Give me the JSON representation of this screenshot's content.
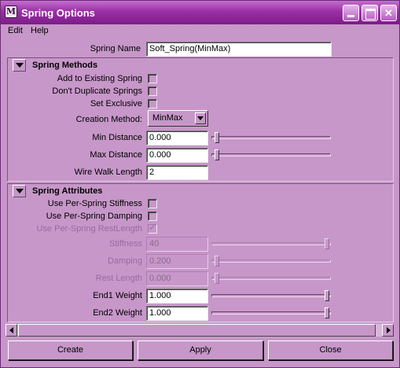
{
  "window": {
    "title": "Spring Options",
    "app_icon": "maya-icon"
  },
  "menubar": {
    "items": [
      "Edit",
      "Help"
    ]
  },
  "spring_name": {
    "label": "Spring Name",
    "value": "Soft_Spring(MinMax)"
  },
  "methods": {
    "header": "Spring Methods",
    "add_existing": {
      "label": "Add to Existing Spring",
      "checked": false
    },
    "dont_duplicate": {
      "label": "Don't Duplicate Springs",
      "checked": false
    },
    "set_exclusive": {
      "label": "Set Exclusive",
      "checked": false
    },
    "creation_method": {
      "label": "Creation Method:",
      "value": "MinMax"
    },
    "min_distance": {
      "label": "Min Distance",
      "value": "0.000",
      "slider_fraction": 0.0
    },
    "max_distance": {
      "label": "Max Distance",
      "value": "0.000",
      "slider_fraction": 0.0
    },
    "wire_walk": {
      "label": "Wire Walk Length",
      "value": "2"
    }
  },
  "attributes": {
    "header": "Spring Attributes",
    "per_spring_stiffness": {
      "label": "Use Per-Spring Stiffness",
      "checked": false
    },
    "per_spring_damping": {
      "label": "Use Per-Spring Damping",
      "checked": false
    },
    "per_spring_rest": {
      "label": "Use Per-Spring RestLength",
      "checked": true,
      "mark": "✓"
    },
    "stiffness": {
      "label": "Stiffness",
      "value": "40",
      "slider_fraction": 1.0
    },
    "damping": {
      "label": "Damping",
      "value": "0.200",
      "slider_fraction": 0.0
    },
    "rest_length": {
      "label": "Rest Length",
      "value": "0.000",
      "slider_fraction": 0.0
    },
    "end1_weight": {
      "label": "End1 Weight",
      "value": "1.000",
      "slider_fraction": 1.0
    },
    "end2_weight": {
      "label": "End2 Weight",
      "value": "1.000",
      "slider_fraction": 1.0
    }
  },
  "buttons": {
    "create": "Create",
    "apply": "Apply",
    "close": "Close"
  }
}
